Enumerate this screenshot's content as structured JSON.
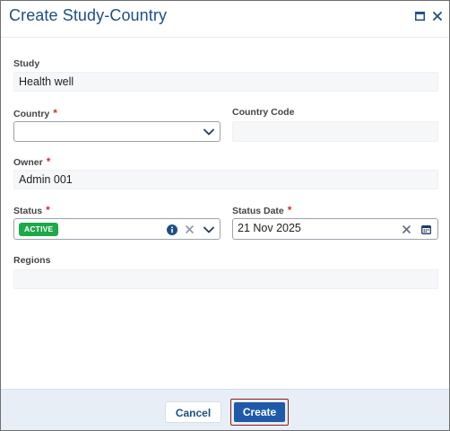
{
  "dialog": {
    "title": "Create Study-Country",
    "maximize_icon": "window-maximize-icon",
    "close_icon": "close-icon"
  },
  "form": {
    "study": {
      "label": "Study",
      "value": "Health well"
    },
    "country": {
      "label": "Country",
      "required_mark": "*",
      "value": "",
      "icon": "chevron-down-icon"
    },
    "country_code": {
      "label": "Country Code",
      "value": ""
    },
    "owner": {
      "label": "Owner",
      "required_mark": "*",
      "value": "Admin 001"
    },
    "status": {
      "label": "Status",
      "required_mark": "*",
      "badge": "ACTIVE",
      "badge_color": "#1fa84a",
      "icons": [
        "info-icon",
        "clear-icon",
        "chevron-down-icon"
      ]
    },
    "status_date": {
      "label": "Status Date",
      "required_mark": "*",
      "value": "21 Nov 2025",
      "icons": [
        "clear-icon",
        "calendar-icon"
      ]
    },
    "regions": {
      "label": "Regions",
      "value": ""
    }
  },
  "footer": {
    "cancel_label": "Cancel",
    "create_label": "Create"
  },
  "colors": {
    "title": "#1f4e86",
    "required": "#d63031",
    "primary": "#1f5aa8",
    "footer_bg": "#e8eef6"
  }
}
